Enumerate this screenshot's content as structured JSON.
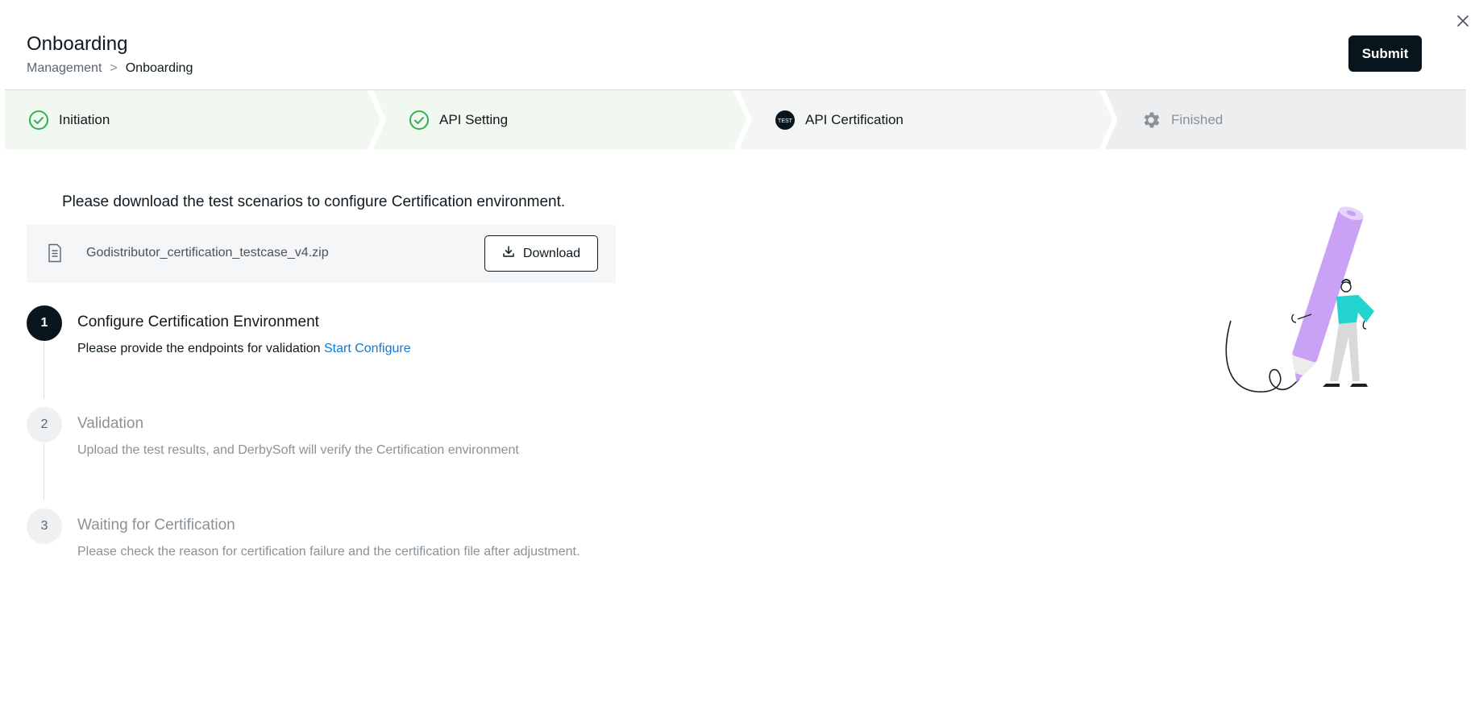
{
  "header": {
    "title": "Onboarding",
    "breadcrumb": {
      "parent": "Management",
      "separator": ">",
      "current": "Onboarding"
    },
    "submit_label": "Submit"
  },
  "steps": [
    {
      "label": "Initiation",
      "status": "completed",
      "icon": "check-circle-icon"
    },
    {
      "label": "API Setting",
      "status": "completed",
      "icon": "check-circle-icon"
    },
    {
      "label": "API Certification",
      "status": "current",
      "icon": "test-badge-icon",
      "icon_text": "TEST"
    },
    {
      "label": "Finished",
      "status": "pending",
      "icon": "gear-icon"
    }
  ],
  "download": {
    "intro": "Please download the test scenarios to configure Certification environment.",
    "file_name": "Godistributor_certification_testcase_v4.zip",
    "button_label": "Download"
  },
  "certification_steps": [
    {
      "number": "1",
      "title": "Configure Certification Environment",
      "description": "Please provide the endpoints for validation",
      "link": "Start Configure",
      "status": "active"
    },
    {
      "number": "2",
      "title": "Validation",
      "description": "Upload the test results, and DerbySoft will verify the Certification environment",
      "status": "inactive"
    },
    {
      "number": "3",
      "title": "Waiting for Certification",
      "description": "Please check the reason for certification failure and the certification file after adjustment.",
      "status": "inactive"
    }
  ],
  "colors": {
    "primary": "#08151c",
    "completed": "#2fb34a",
    "completed_bg": "#f0f8f0",
    "current_bg": "#f3f6f4",
    "pending_bg": "#eceeef",
    "link": "#1479d1",
    "pencil": "#c9a2f5",
    "person_shirt": "#22d3cf"
  }
}
